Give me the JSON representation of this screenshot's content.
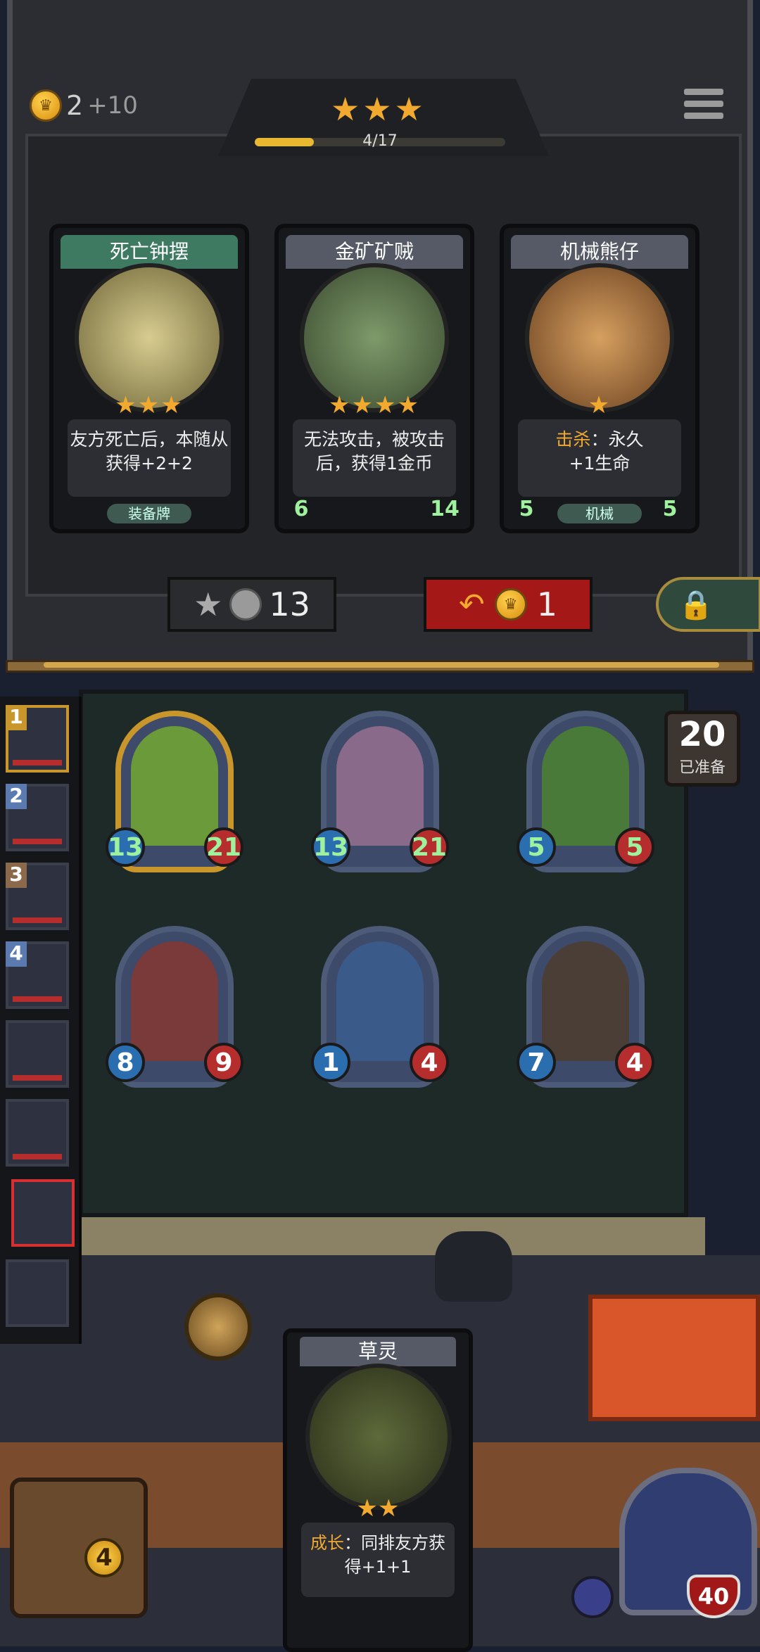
{
  "top": {
    "gold": "2",
    "gold_income": "+10",
    "tier_stars": "★★★",
    "xp_progress": "4/17",
    "xp_fraction": 0.235
  },
  "shop_cards": [
    {
      "name": "死亡钟摆",
      "stars": "★★★",
      "desc_lines": [
        "友方死亡后，本随从",
        "获得+2+2"
      ],
      "tag": "装备牌",
      "attack": "",
      "health": "",
      "color": "#3e7a62"
    },
    {
      "name": "金矿矿贼",
      "stars": "★★★★",
      "desc_lines": [
        "无法攻击，被攻击",
        "后，获得1金币"
      ],
      "tag": "",
      "attack": "6",
      "health": "14",
      "color": "#555a66"
    },
    {
      "name": "机械熊仔",
      "stars": "★",
      "desc_keyword": "击杀",
      "desc_rest": "：永久",
      "desc_line2": "+1生命",
      "tag": "机械",
      "attack": "5",
      "health": "5",
      "color": "#555a66"
    }
  ],
  "buttons": {
    "upgrade_cost": "13",
    "refresh_cost": "1"
  },
  "prep": {
    "count": "20",
    "label": "已准备"
  },
  "players": [
    {
      "rank": "1"
    },
    {
      "rank": "2"
    },
    {
      "rank": "3"
    },
    {
      "rank": "4"
    },
    {
      "rank": ""
    },
    {
      "rank": ""
    },
    {
      "rank": ""
    },
    {
      "rank": ""
    }
  ],
  "board": [
    {
      "attack": "13",
      "health": "21",
      "golden": true
    },
    {
      "attack": "13",
      "health": "21",
      "golden": false
    },
    {
      "attack": "5",
      "health": "5",
      "golden": false
    },
    {
      "attack": "8",
      "health": "9",
      "golden": false
    },
    {
      "attack": "1",
      "health": "4",
      "golden": false
    },
    {
      "attack": "7",
      "health": "4",
      "golden": false
    }
  ],
  "hand_card": {
    "name": "草灵",
    "stars": "★★",
    "desc_keyword": "成长",
    "desc_rest": "：同排友方获",
    "desc_line2": "得+1+1"
  },
  "chest_count": "4",
  "hero_health": "40"
}
